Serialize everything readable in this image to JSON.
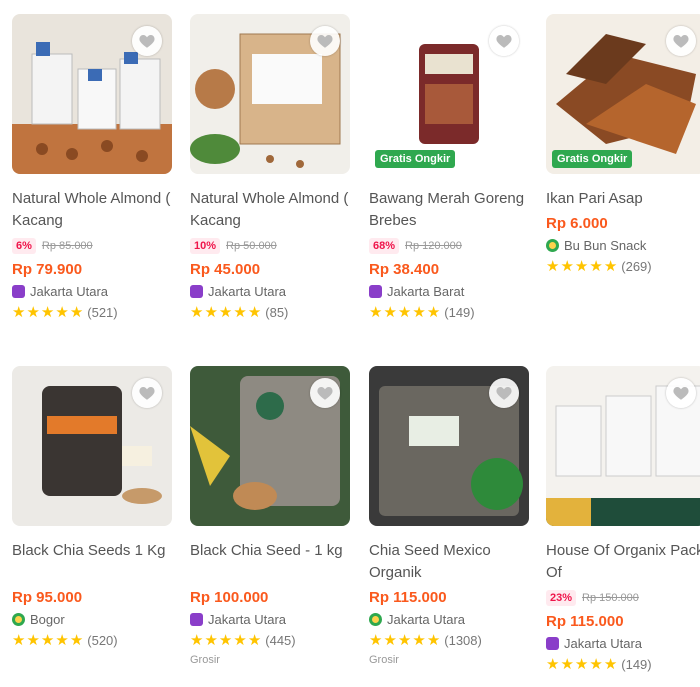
{
  "colors": {
    "price": "#fa591d",
    "discount": "#ef144a",
    "ongkir": "#2fa84f",
    "star": "#ffc400"
  },
  "products": [
    {
      "name": "Natural Whole Almond ( Kacang",
      "discount": "6%",
      "original_price": "Rp 85.000",
      "price": "Rp 79.900",
      "location": "Jakarta Utara",
      "badge": "official-store",
      "rating_count": "(521)",
      "ongkir": ""
    },
    {
      "name": "Natural Whole Almond ( Kacang",
      "discount": "10%",
      "original_price": "Rp 50.000",
      "price": "Rp 45.000",
      "location": "Jakarta Utara",
      "badge": "official-store",
      "rating_count": "(85)",
      "ongkir": ""
    },
    {
      "name": "Bawang Merah Goreng Brebes",
      "discount": "68%",
      "original_price": "Rp 120.000",
      "price": "Rp 38.400",
      "location": "Jakarta Barat",
      "badge": "official-store",
      "rating_count": "(149)",
      "ongkir": "Gratis Ongkir"
    },
    {
      "name": "Ikan Pari Asap",
      "discount": "",
      "original_price": "",
      "price": "Rp 6.000",
      "location": "Bu Bun Snack",
      "badge": "power-merchant",
      "rating_count": "(269)",
      "ongkir": "Gratis Ongkir"
    },
    {
      "name": "Black Chia Seeds 1 Kg",
      "discount": "",
      "original_price": "",
      "price": "Rp 95.000",
      "location": "Bogor",
      "badge": "power-merchant",
      "rating_count": "(520)",
      "ongkir": ""
    },
    {
      "name": "Black Chia Seed - 1 kg",
      "discount": "",
      "original_price": "",
      "price": "Rp 100.000",
      "location": "Jakarta Utara",
      "badge": "official-store",
      "rating_count": "(445)",
      "extra": "Grosir"
    },
    {
      "name": "Chia Seed Mexico Organik",
      "discount": "",
      "original_price": "",
      "price": "Rp 115.000",
      "location": "Jakarta Utara",
      "badge": "power-merchant",
      "rating_count": "(1308)",
      "extra": "Grosir"
    },
    {
      "name": "House Of Organix Pack Of",
      "discount": "23%",
      "original_price": "Rp 150.000",
      "price": "Rp 115.000",
      "location": "Jakarta Utara",
      "badge": "official-store",
      "rating_count": "(149)"
    }
  ]
}
